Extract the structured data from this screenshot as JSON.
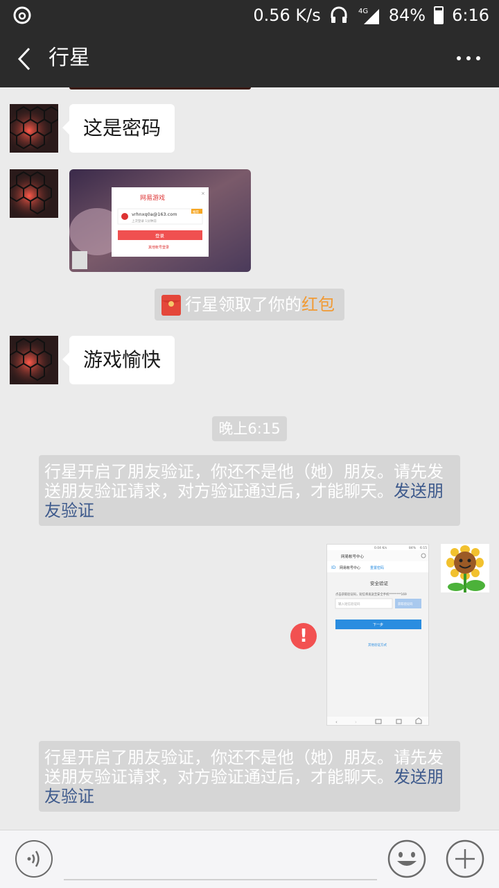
{
  "status_bar": {
    "speed": "0.56 K/s",
    "network": "4G",
    "battery": "84%",
    "time": "6:16"
  },
  "title_bar": {
    "title": "行星"
  },
  "messages": {
    "text1": "这是密码",
    "screenshot_dialog": {
      "brand": "网易游戏",
      "account": "vrhnxq0a@163.com",
      "hint": "上次登录 1分钟前",
      "badge": "推荐",
      "login_button": "登录",
      "other_account": "其他帐号登录"
    },
    "redpacket_prefix": "行星领取了你的",
    "redpacket_link": "红包",
    "text2": "游戏愉快",
    "time_label": "晚上6:15",
    "system_note": "行星开启了朋友验证，你还不是他（她）朋友。请先发送朋友验证请求，对方验证通过后，才能聊天。",
    "system_link": "发送朋友验证",
    "sent_screenshot": {
      "status": "0.04 K/s",
      "battery": "84%",
      "time": "6:15",
      "header": "网易帐号中心",
      "nav_brand": "网易帐号中心",
      "nav_tab": "重置密码",
      "heading": "安全验证",
      "desc": "点击获取验证码，短信将发送至安全手机********169",
      "input_placeholder": "输入短信验证码",
      "get_code": "获取验证码",
      "next": "下一步",
      "other": "其他验证方式"
    }
  },
  "input_bar": {
    "placeholder": ""
  },
  "colors": {
    "bar": "#2b2b2b",
    "background": "#ebebeb",
    "system_note": "#d6d6d6",
    "link_blue": "#3e5a8c",
    "link_orange": "#f19a34",
    "error": "#f25151"
  }
}
